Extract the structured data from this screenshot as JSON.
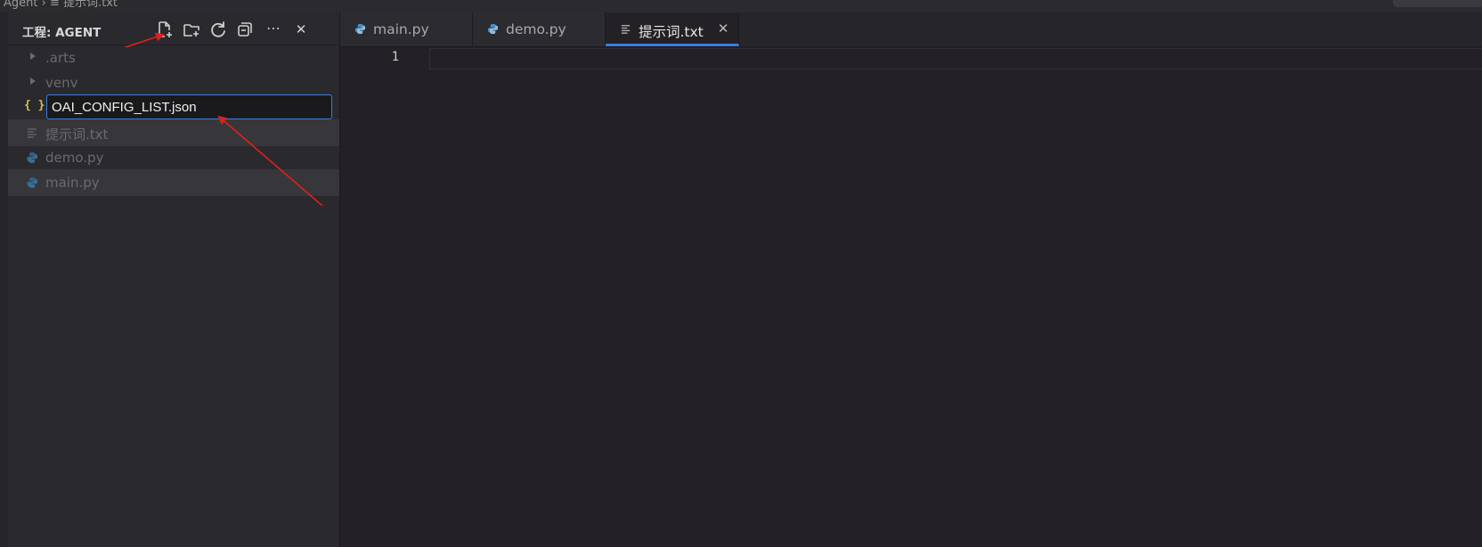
{
  "window": {
    "breadcrumb": "Agent  ›  ≡  提示词.txt"
  },
  "sidebar": {
    "title": "工程: AGENT",
    "toolbar": [
      {
        "name": "new-file-icon"
      },
      {
        "name": "new-folder-icon"
      },
      {
        "name": "refresh-icon"
      },
      {
        "name": "collapse-all-icon"
      },
      {
        "name": "more-icon",
        "glyph": "⋯"
      },
      {
        "name": "close-icon",
        "glyph": "✕"
      }
    ],
    "tree": [
      {
        "type": "folder",
        "label": ".arts"
      },
      {
        "type": "folder",
        "label": "venv"
      },
      {
        "type": "rename",
        "icon": "{ }",
        "value": "OAI_CONFIG_LIST.json"
      },
      {
        "type": "file",
        "icon": "text-file-icon",
        "label": "提示词.txt"
      },
      {
        "type": "file",
        "icon": "python-file-icon",
        "label": "demo.py"
      },
      {
        "type": "file",
        "icon": "python-file-icon",
        "label": "main.py"
      }
    ]
  },
  "tabs": [
    {
      "label": "main.py",
      "icon": "python-file-icon",
      "active": false
    },
    {
      "label": "demo.py",
      "icon": "python-file-icon",
      "active": false
    },
    {
      "label": "提示词.txt",
      "icon": "text-file-icon",
      "active": true,
      "close": "✕"
    }
  ],
  "editor": {
    "line_numbers": [
      "1"
    ]
  },
  "colors": {
    "accent": "#3b7de0",
    "annotation_arrow": "#e0201c",
    "python_icon": "#4a90c8",
    "json_icon": "#d8c04a"
  }
}
